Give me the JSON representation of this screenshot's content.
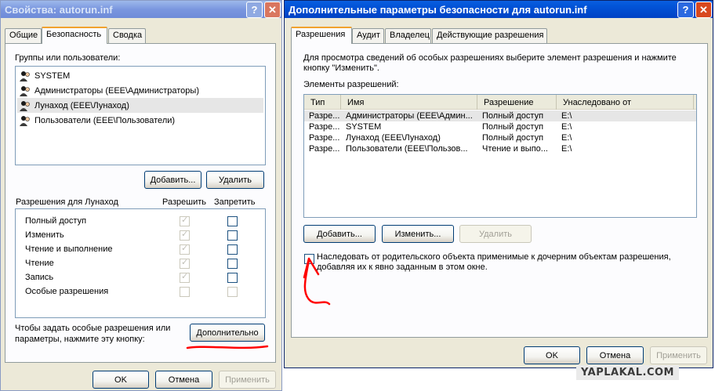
{
  "left_window": {
    "title": "Свойства: autorun.inf",
    "tabs": [
      "Общие",
      "Безопасность",
      "Сводка"
    ],
    "groups_label": "Группы или пользователи:",
    "users": [
      "SYSTEM",
      "Администраторы (EEE\\Администраторы)",
      "Лунаход (EEE\\Лунаход)",
      "Пользователи (EEE\\Пользователи)"
    ],
    "add_label": "Добавить...",
    "remove_label": "Удалить",
    "perm_header": "Разрешения для Лунаход",
    "allow_label": "Разрешить",
    "deny_label": "Запретить",
    "permissions": [
      {
        "name": "Полный доступ",
        "allow": true,
        "deny": false
      },
      {
        "name": "Изменить",
        "allow": true,
        "deny": false
      },
      {
        "name": "Чтение и выполнение",
        "allow": true,
        "deny": false
      },
      {
        "name": "Чтение",
        "allow": true,
        "deny": false
      },
      {
        "name": "Запись",
        "allow": true,
        "deny": false
      },
      {
        "name": "Особые разрешения",
        "allow": false,
        "deny": false
      }
    ],
    "advanced_hint_1": "Чтобы задать особые разрешения или",
    "advanced_hint_2": "параметры, нажмите эту кнопку:",
    "advanced_label": "Дополнительно",
    "ok_label": "OK",
    "cancel_label": "Отмена",
    "apply_label": "Применить"
  },
  "right_window": {
    "title": "Дополнительные параметры безопасности для autorun.inf",
    "tabs": [
      "Разрешения",
      "Аудит",
      "Владелец",
      "Действующие разрешения"
    ],
    "info_line_1": "Для просмотра сведений об особых разрешениях выберите элемент разрешения и нажмите",
    "info_line_2": "кнопку \"Изменить\".",
    "elements_label": "Элементы разрешений:",
    "columns": [
      "Тип",
      "Имя",
      "Разрешение",
      "Унаследовано от"
    ],
    "rows": [
      {
        "type": "Разре...",
        "name": "Администраторы (EEE\\Админ...",
        "perm": "Полный доступ",
        "inherited": "E:\\"
      },
      {
        "type": "Разре...",
        "name": "SYSTEM",
        "perm": "Полный доступ",
        "inherited": "E:\\"
      },
      {
        "type": "Разре...",
        "name": "Лунаход (EEE\\Лунаход)",
        "perm": "Полный доступ",
        "inherited": "E:\\"
      },
      {
        "type": "Разре...",
        "name": "Пользователи (EEE\\Пользов...",
        "perm": "Чтение и выпо...",
        "inherited": "E:\\"
      }
    ],
    "add_label": "Добавить...",
    "edit_label": "Изменить...",
    "remove_label": "Удалить",
    "inherit_line_1": "Наследовать от родительского объекта применимые к дочерним объектам разрешения,",
    "inherit_line_2": "добавляя их к явно заданным в этом окне.",
    "inherit_checked": false,
    "ok_label": "OK",
    "cancel_label": "Отмена",
    "apply_label": "Применить"
  },
  "watermark": "YAPLAKAL.COM",
  "icons": {
    "help": "question-icon",
    "close": "close-icon",
    "user": "user-group-icon"
  },
  "colors": {
    "annotation": "#ff0000",
    "active_title": "#0054e3",
    "inactive_title": "#7a96df",
    "window_bg": "#ece9d8"
  }
}
